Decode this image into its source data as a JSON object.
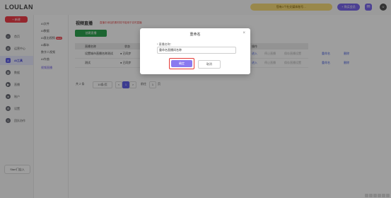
{
  "app": {
    "logo": "LOULAN"
  },
  "topbar": {
    "notice": "您有1个社交媒体账号…",
    "trial_label": "+ 购买会员",
    "avatar_text": "U"
  },
  "sidebar": {
    "new_button": "+ 新建",
    "items": [
      {
        "label": "首页",
        "icon": "home-icon",
        "glyph": "⌂"
      },
      {
        "label": "运营中心",
        "icon": "compass-icon",
        "glyph": "◎"
      },
      {
        "label": "AI工具",
        "icon": "ai-icon",
        "glyph": "A",
        "active": true
      },
      {
        "label": "数据",
        "icon": "chart-icon",
        "glyph": "▤"
      },
      {
        "label": "直播",
        "icon": "live-icon",
        "glyph": "▶"
      },
      {
        "label": "账户",
        "icon": "user-icon",
        "glyph": "●"
      },
      {
        "label": "设置",
        "icon": "settings-icon",
        "glyph": "⚙"
      },
      {
        "label": "团队协作",
        "icon": "team-icon",
        "glyph": "◇"
      }
    ],
    "start_button": "Start门店入"
  },
  "submenu": {
    "items": [
      {
        "label": "AI文件"
      },
      {
        "label": "AI数据"
      },
      {
        "label": "AI直出视频",
        "badge": "NEW"
      },
      {
        "label": "AI脚本"
      },
      {
        "label": "数字人视频"
      },
      {
        "label": "AI作曲"
      },
      {
        "label": "视频直播",
        "active": true
      }
    ]
  },
  "page": {
    "title": "视频直播",
    "warning": "直播中添加的素材将不能用于实时直播",
    "create_button": "创建直播",
    "table": {
      "headers": [
        "直播名称",
        "状态",
        "操作"
      ],
      "rows": [
        {
          "name": "设置城市直播名称测试",
          "status": "● 已同步",
          "actions": [
            "进入",
            "停止直播",
            "保存直播设置",
            "重命名",
            "删除"
          ]
        },
        {
          "name": "测试",
          "status": "● 已同步",
          "actions": [
            "进入",
            "停止直播",
            "保存直播设置",
            "重命名",
            "删除"
          ]
        }
      ]
    },
    "pager": {
      "total": "共 2 条",
      "page_size": "10条/页",
      "prev": "<",
      "current": "1",
      "next": ">",
      "goto_label": "前往",
      "goto_value": "1",
      "page_suffix": "页"
    }
  },
  "modal": {
    "title": "重命名",
    "close": "×",
    "field_label": "* 直播名称：",
    "input_value": "重命名直播间名称",
    "confirm": "确定",
    "cancel": "取消"
  }
}
